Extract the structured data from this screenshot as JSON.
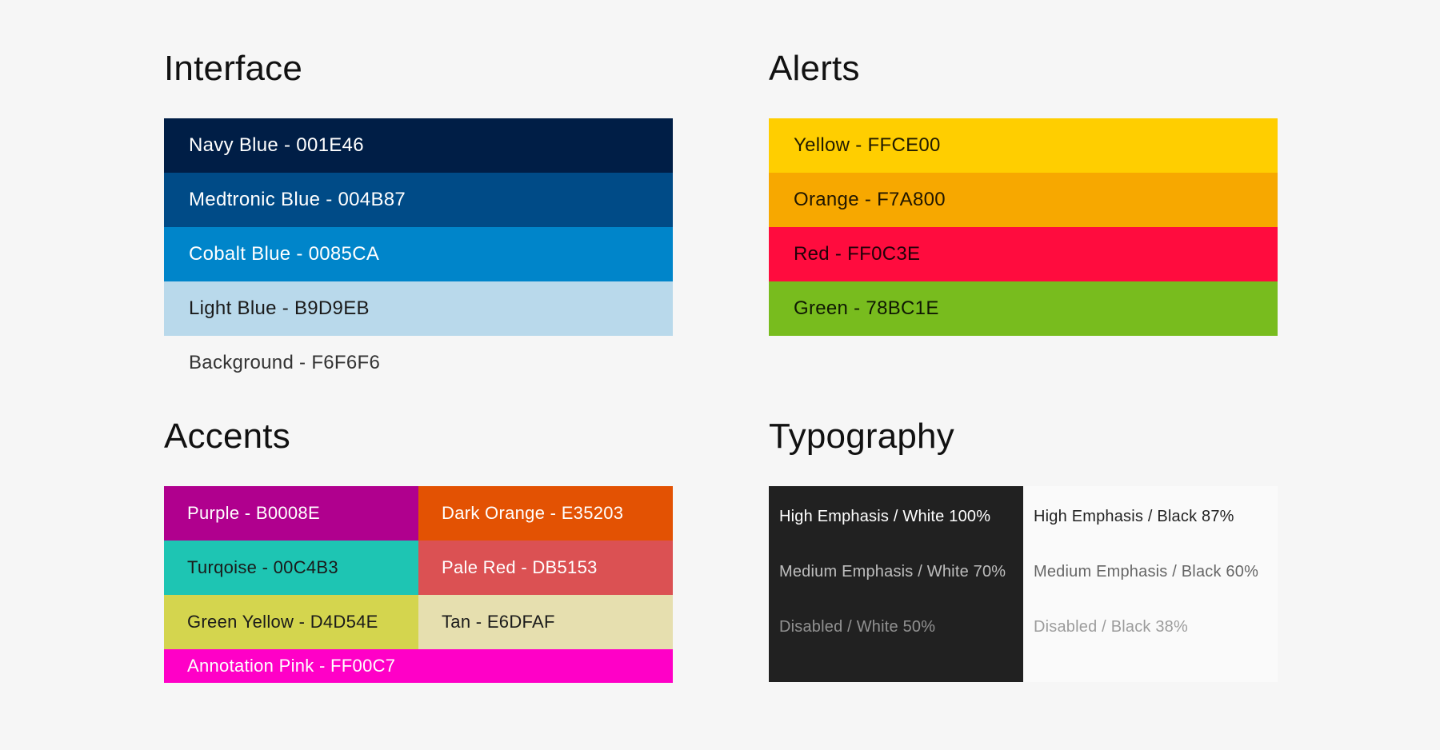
{
  "sections": {
    "interface": {
      "title": "Interface",
      "swatches": [
        {
          "label": "Navy Blue - 001E46",
          "color": "#001E46",
          "text_color": "#FFFFFF"
        },
        {
          "label": "Medtronic Blue - 004B87",
          "color": "#004B87",
          "text_color": "#FFFFFF"
        },
        {
          "label": "Cobalt Blue - 0085CA",
          "color": "#0085CA",
          "text_color": "#FFFFFF"
        },
        {
          "label": "Light Blue - B9D9EB",
          "color": "#B9D9EB",
          "text_color": "#1A1A1A"
        },
        {
          "label": "Background - F6F6F6",
          "color": "#F6F6F6",
          "text_color": "#333333"
        }
      ]
    },
    "alerts": {
      "title": "Alerts",
      "swatches": [
        {
          "label": "Yellow - FFCE00",
          "color": "#FFCE00"
        },
        {
          "label": "Orange - F7A800",
          "color": "#F7A800"
        },
        {
          "label": "Red - FF0C3E",
          "color": "#FF0C3E"
        },
        {
          "label": "Green - 78BC1E",
          "color": "#78BC1E"
        }
      ]
    },
    "accents": {
      "title": "Accents",
      "swatches": [
        {
          "label": "Purple - B0008E",
          "color": "#B0008E",
          "text_color": "#FFFFFF"
        },
        {
          "label": "Dark Orange - E35203",
          "color": "#E35203",
          "text_color": "#FFFFFF"
        },
        {
          "label": "Turqoise - 00C4B3",
          "color": "#1EC5B3",
          "text_color": "#1A1A1A"
        },
        {
          "label": "Pale Red - DB5153",
          "color": "#DB5153",
          "text_color": "#FFFFFF"
        },
        {
          "label": "Green Yellow - D4D54E",
          "color": "#D4D54E",
          "text_color": "#1A1A1A"
        },
        {
          "label": "Tan - E6DFAF",
          "color": "#E6DFAF",
          "text_color": "#1A1A1A"
        },
        {
          "label": "Annotation Pink - FF00C7",
          "color": "#FF00C7",
          "text_color": "#FFFFFF"
        }
      ]
    },
    "typography": {
      "title": "Typography",
      "dark_panel": {
        "background": "#212121",
        "lines": [
          {
            "label": "High Emphasis / White 100%",
            "color": "rgba(255,255,255,1)"
          },
          {
            "label": "Medium Emphasis / White 70%",
            "color": "rgba(255,255,255,0.7)"
          },
          {
            "label": "Disabled / White 50%",
            "color": "rgba(255,255,255,0.5)"
          }
        ]
      },
      "light_panel": {
        "background": "#FAFAFA",
        "lines": [
          {
            "label": "High Emphasis / Black 87%",
            "color": "rgba(0,0,0,0.87)"
          },
          {
            "label": "Medium Emphasis / Black 60%",
            "color": "rgba(0,0,0,0.6)"
          },
          {
            "label": "Disabled / Black 38%",
            "color": "rgba(0,0,0,0.38)"
          }
        ]
      }
    }
  }
}
